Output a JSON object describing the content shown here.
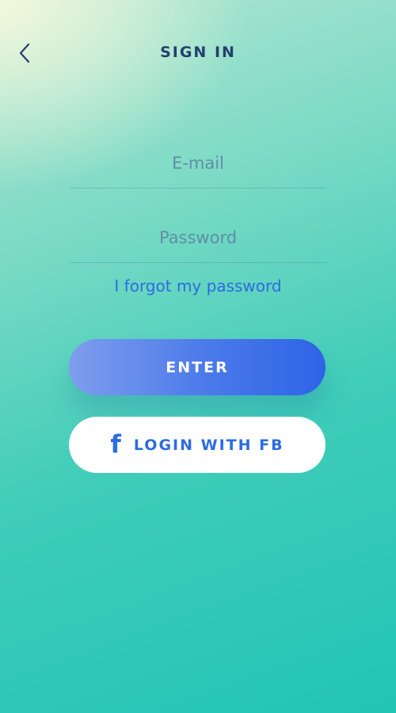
{
  "header": {
    "title": "SIGN IN",
    "back_icon": "chevron-left-icon"
  },
  "form": {
    "email_placeholder": "E-mail",
    "email_value": "",
    "password_placeholder": "Password",
    "password_value": "",
    "forgot_label": "I forgot my password"
  },
  "actions": {
    "enter_label": "ENTER",
    "fb_icon": "facebook-icon",
    "fb_icon_glyph": "f",
    "fb_label": "LOGIN WITH FB"
  },
  "colors": {
    "title": "#233f6e",
    "accent_blue": "#2d6be2",
    "background_top": "#f3f8dc",
    "background_bottom": "#22c4b6",
    "enter_gradient_start": "#7f9ded",
    "enter_gradient_end": "#2e63e6"
  }
}
